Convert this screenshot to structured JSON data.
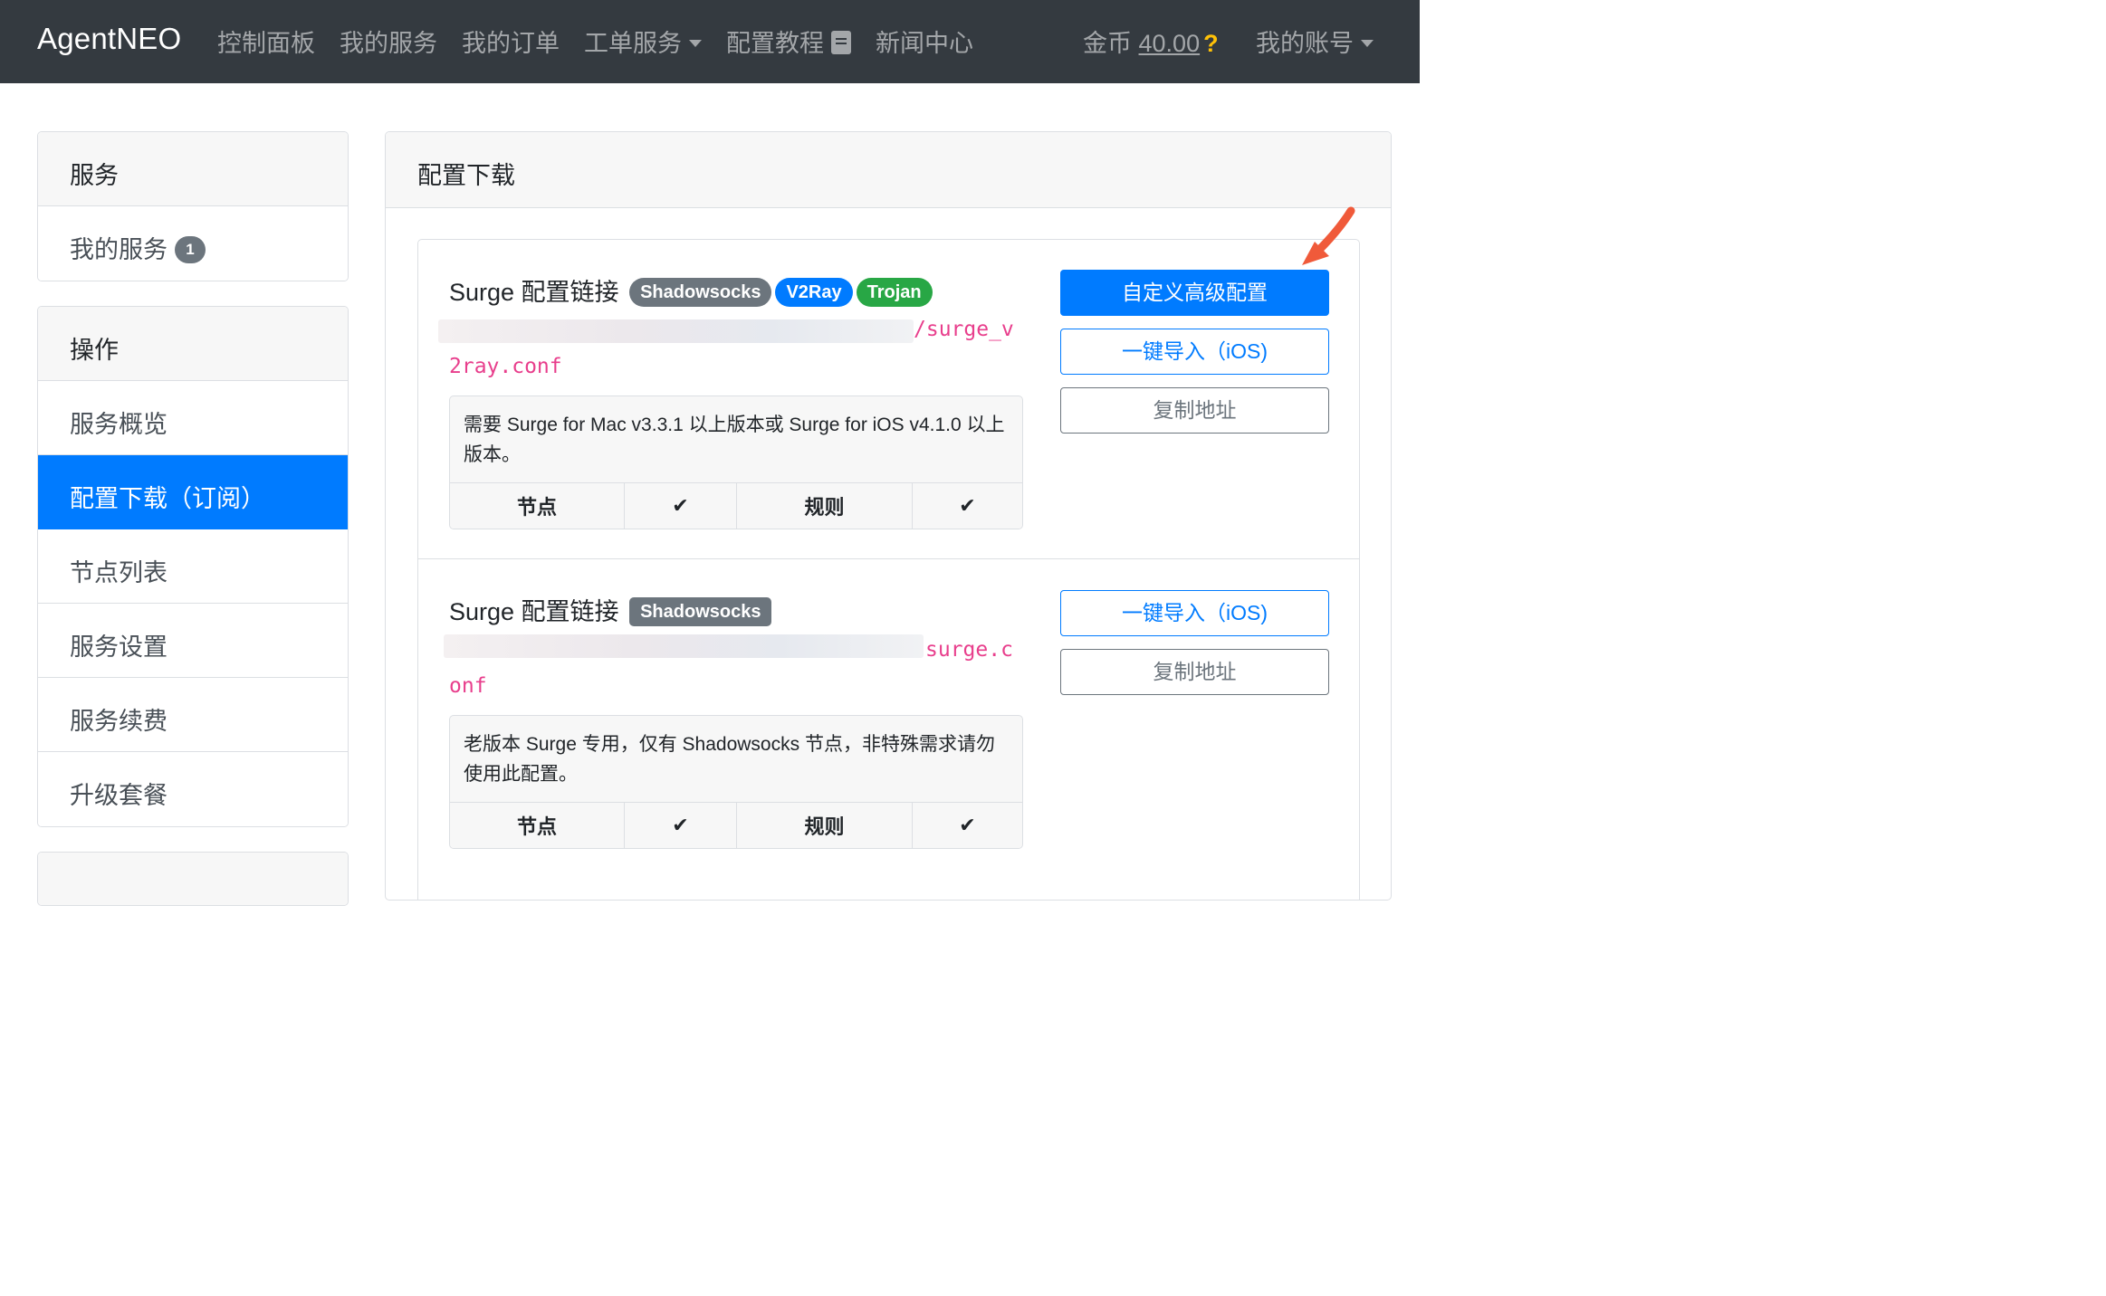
{
  "navbar": {
    "brand": "AgentNEO",
    "links": [
      "控制面板",
      "我的服务",
      "我的订单",
      "工单服务",
      "配置教程",
      "新闻中心"
    ],
    "coins_label": "金币",
    "coins_value": "40.00",
    "coins_help": "?",
    "account": "我的账号"
  },
  "sidebar": {
    "service_header": "服务",
    "my_services": "我的服务",
    "my_services_count": "1",
    "ops_header": "操作",
    "items": [
      "服务概览",
      "配置下载（订阅）",
      "节点列表",
      "服务设置",
      "服务续费",
      "升级套餐"
    ]
  },
  "main": {
    "header": "配置下载",
    "configs": [
      {
        "title": "Surge 配置链接",
        "tags": [
          "Shadowsocks",
          "V2Ray",
          "Trojan"
        ],
        "url_line1": "/surge_v",
        "url_line2": "2ray.conf",
        "description": "需要 Surge for Mac v3.3.1 以上版本或 Surge for iOS v4.1.0 以上版本。",
        "nodes_label": "节点",
        "rules_label": "规则",
        "buttons": [
          "自定义高级配置",
          "一键导入（iOS)",
          "复制地址"
        ]
      },
      {
        "title": "Surge 配置链接",
        "tags": [
          "Shadowsocks"
        ],
        "url_line1": "surge.c",
        "url_line2": "onf",
        "description": "老版本 Surge 专用，仅有 Shadowsocks 节点，非特殊需求请勿使用此配置。",
        "nodes_label": "节点",
        "rules_label": "规则",
        "buttons": [
          "一键导入（iOS)",
          "复制地址"
        ]
      }
    ]
  },
  "colors": {
    "navbar_bg": "#343a40",
    "primary": "#007bff",
    "success": "#28a745",
    "secondary": "#6c757d",
    "url_pink": "#e83e8c",
    "arrow": "#f05a3a"
  },
  "icons": [
    "caret-down-icon",
    "book-icon",
    "question-icon",
    "check-icon",
    "arrow-annotation"
  ]
}
